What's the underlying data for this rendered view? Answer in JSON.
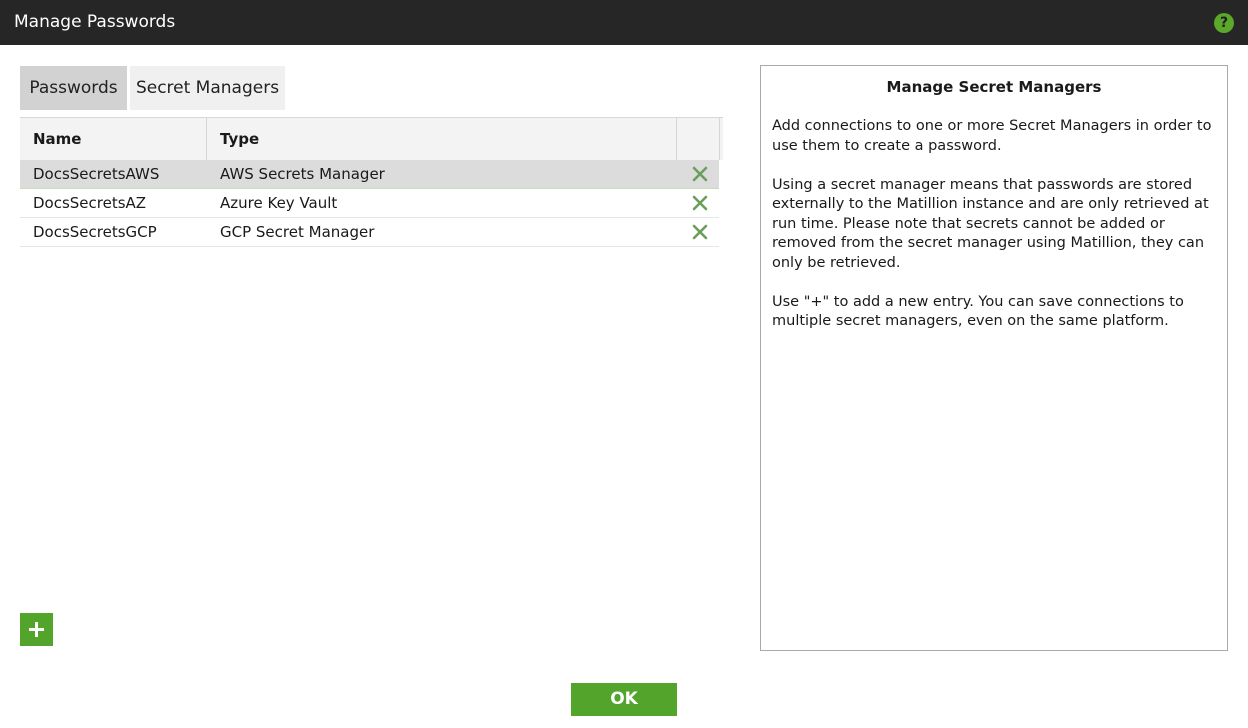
{
  "window": {
    "title": "Manage Passwords",
    "help_icon": "question-circle-icon",
    "help_label": "?"
  },
  "tabs": [
    {
      "label": "Passwords",
      "active": true
    },
    {
      "label": "Secret Managers",
      "active": false
    }
  ],
  "table": {
    "columns": [
      "Name",
      "Type"
    ],
    "rows": [
      {
        "name": "DocsSecretsAWS",
        "type": "AWS Secrets Manager",
        "selected": true
      },
      {
        "name": "DocsSecretsAZ",
        "type": "Azure Key Vault",
        "selected": false
      },
      {
        "name": "DocsSecretsGCP",
        "type": "GCP Secret Manager",
        "selected": false
      }
    ],
    "delete_icon": "close-x-icon"
  },
  "add_button": {
    "icon": "plus-icon"
  },
  "info_panel": {
    "title": "Manage Secret Managers",
    "paragraphs": [
      "Add connections to one or more Secret Managers in order to use them to create a password.",
      "Using a secret manager means that passwords are stored externally to the Matillion instance and are only retrieved at run time. Please note that secrets cannot be added or removed from the secret manager using Matillion, they can only be retrieved.",
      "Use \"+\" to add a new entry. You can save connections to multiple secret managers, even on the same platform."
    ]
  },
  "footer": {
    "ok_label": "OK"
  },
  "colors": {
    "titlebar": "#262626",
    "accent_green": "#52a42a",
    "delete_green": "#6a9e5a"
  }
}
